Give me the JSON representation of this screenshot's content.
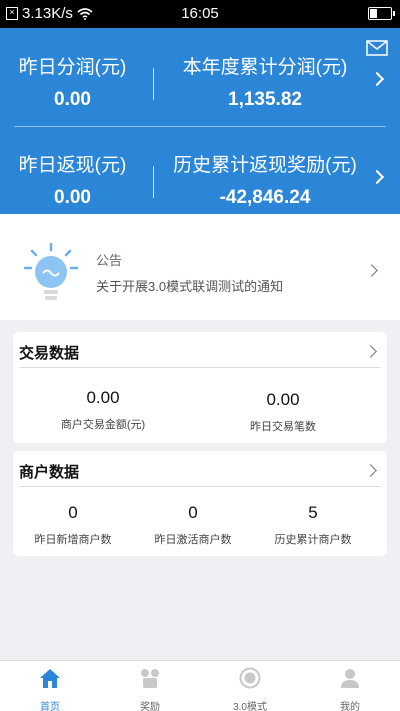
{
  "status_bar": {
    "network_speed": "3.13K/s",
    "time": "16:05"
  },
  "summary": {
    "yesterday_profit_label": "昨日分润(元)",
    "yesterday_profit_value": "0.00",
    "year_profit_label": "本年度累计分润(元)",
    "year_profit_value": "1,135.82",
    "yesterday_cashback_label": "昨日返现(元)",
    "yesterday_cashback_value": "0.00",
    "history_cashback_label": "历史累计返现奖励(元)",
    "history_cashback_value": "-42,846.24"
  },
  "notice": {
    "title": "公告",
    "text": "关于开展3.0模式联调测试的通知"
  },
  "trade_card": {
    "title": "交易数据",
    "items": [
      {
        "value": "0.00",
        "caption": "商户交易金额(元)"
      },
      {
        "value": "0.00",
        "caption": "昨日交易笔数"
      }
    ]
  },
  "merchant_card": {
    "title": "商户数据",
    "items": [
      {
        "value": "0",
        "caption": "昨日新增商户数"
      },
      {
        "value": "0",
        "caption": "昨日激活商户数"
      },
      {
        "value": "5",
        "caption": "历史累计商户数"
      }
    ]
  },
  "tabs": [
    {
      "label": "首页",
      "icon": "home-icon",
      "active": true
    },
    {
      "label": "奖励",
      "icon": "reward-icon",
      "active": false
    },
    {
      "label": "3.0模式",
      "icon": "mode-icon",
      "active": false
    },
    {
      "label": "我的",
      "icon": "profile-icon",
      "active": false
    }
  ],
  "colors": {
    "brand_blue": "#2c86d8",
    "background": "#efeff4"
  }
}
